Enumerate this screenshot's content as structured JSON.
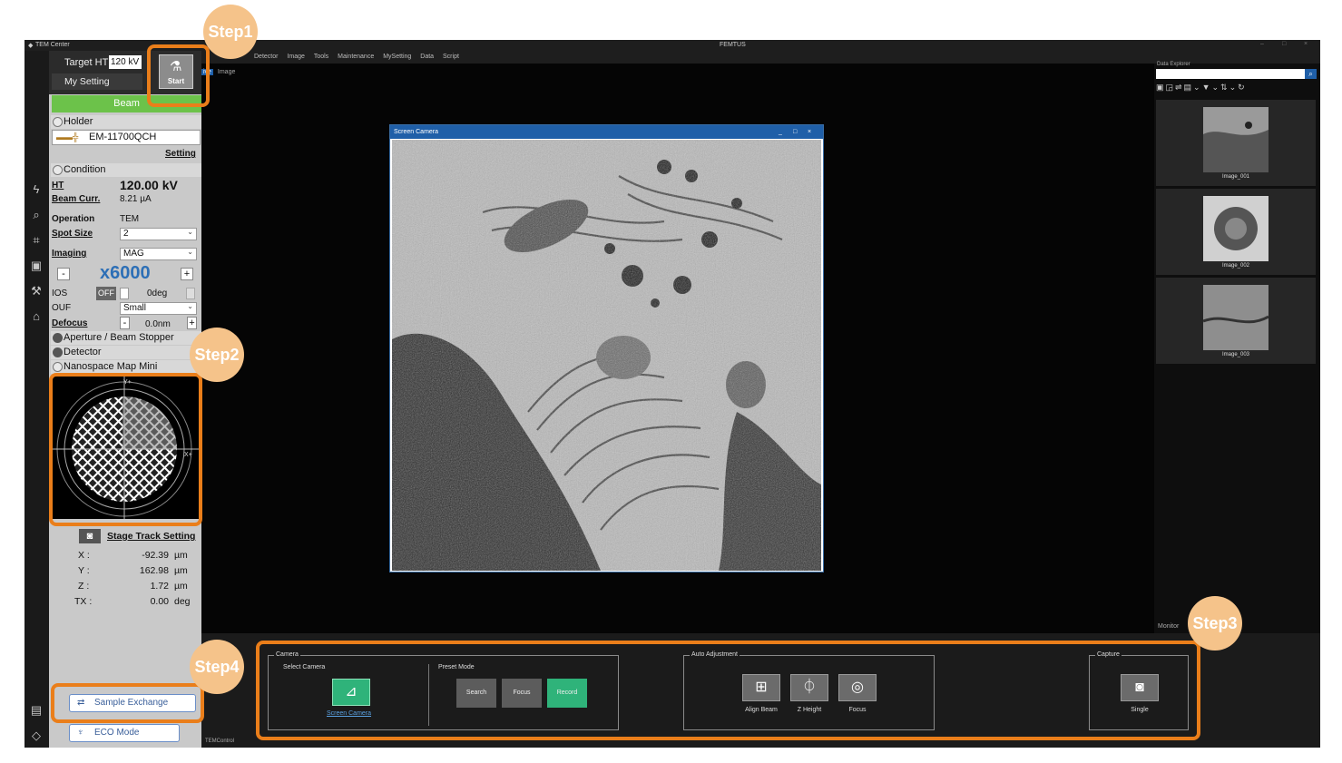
{
  "titlebar": {
    "app_name": "TEM Center",
    "center_title": "FEMTUS",
    "window_controls": [
      "–",
      "□",
      "×"
    ]
  },
  "menubar": {
    "items": [
      "Detector",
      "Image",
      "Tools",
      "Maintenance",
      "MySetting",
      "Data",
      "Script"
    ]
  },
  "viewer_tabs": {
    "live": "ive",
    "image": "Image"
  },
  "left_panel": {
    "target_ht_label": "Target HT",
    "target_ht_value": "120 kV",
    "my_setting": "My Setting",
    "start_label": "Start",
    "beam_label": "Beam",
    "holder": {
      "section": "Holder",
      "name": "EM-11700QCH",
      "setting_link": "Setting"
    },
    "condition": {
      "section": "Condition",
      "ht_label": "HT",
      "ht_value": "120.00 kV",
      "beam_curr_label": "Beam Curr.",
      "beam_curr_value": "8.21 µA",
      "operation_label": "Operation",
      "operation_value": "TEM",
      "spot_size_label": "Spot Size",
      "spot_size_value": "2",
      "imaging_label": "Imaging",
      "imaging_value": "MAG",
      "mag_value": "x6000",
      "minus": "-",
      "plus": "+",
      "ios_label": "IOS",
      "ios_state": "OFF",
      "ios_angle": "0deg",
      "ouf_label": "OUF",
      "ouf_value": "Small",
      "defocus_label": "Defocus",
      "defocus_value": "0.0nm"
    },
    "sections_collapsed": [
      "Aperture / Beam Stopper",
      "Detector"
    ],
    "nanospace": {
      "section": "Nanospace Map Mini",
      "y_label": "Y+",
      "x_label": "X+"
    },
    "stage_track_setting": "Stage Track Setting",
    "coords": [
      {
        "axis": "X :",
        "value": "-92.39",
        "unit": "µm"
      },
      {
        "axis": "Y :",
        "value": "162.98",
        "unit": "µm"
      },
      {
        "axis": "Z :",
        "value": "1.72",
        "unit": "µm"
      },
      {
        "axis": "TX :",
        "value": "0.00",
        "unit": "deg"
      }
    ],
    "sample_exchange": "Sample Exchange",
    "eco_mode": "ECO Mode"
  },
  "camera_window": {
    "title": "Screen Camera",
    "controls": [
      "_",
      "□",
      "×"
    ]
  },
  "data_explorer": {
    "title": "Data Explorer",
    "thumbnails": [
      "Image_001",
      "Image_002",
      "Image_003"
    ],
    "monitor_label": "Monitor"
  },
  "ribbon": {
    "camera_group": "Camera",
    "select_camera": "Select Camera",
    "screen_camera": "Screen Camera",
    "preset_mode": "Preset Mode",
    "presets": [
      "Search",
      "Focus",
      "Record"
    ],
    "active_preset": "Record",
    "auto_adjust_group": "Auto Adjustment",
    "auto_buttons": [
      "Align Beam",
      "Z Height",
      "Focus"
    ],
    "capture_group": "Capture",
    "single": "Single",
    "bottom_tabs": [
      "TEMControl"
    ]
  },
  "steps": [
    "Step1",
    "Step2",
    "Step3",
    "Step4"
  ],
  "colors": {
    "highlight": "#ea7e1a",
    "step_circle": "#f5c38a",
    "beam_green": "#6cc24a",
    "mag_blue": "#2d6fb6",
    "record_green": "#2fb37a"
  }
}
